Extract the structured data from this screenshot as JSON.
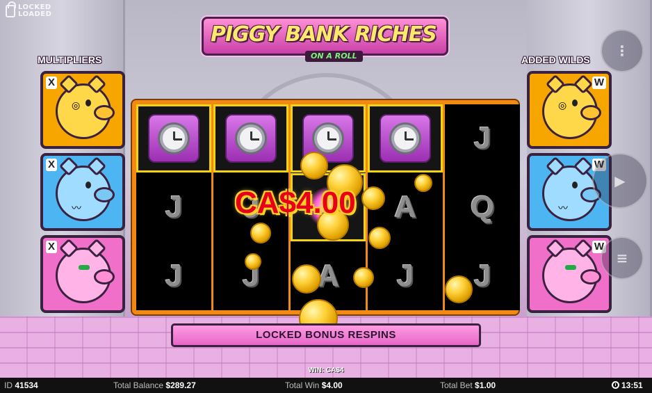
{
  "brand": {
    "line1": "LOCKED",
    "line2": "LOADED"
  },
  "logo": {
    "title": "PIGGY BANK RICHES",
    "subtitle": "ON A ROLL"
  },
  "left_panel": {
    "title": "MULTIPLIERS",
    "slots": [
      {
        "tag": "X",
        "pig": "gold-piggy-monocle-icon"
      },
      {
        "tag": "X",
        "pig": "blue-piggy-mustache-icon"
      },
      {
        "tag": "X",
        "pig": "pink-piggy-sunglasses-icon"
      }
    ]
  },
  "right_panel": {
    "title": "ADDED WILDS",
    "slots": [
      {
        "tag": "W",
        "pig": "gold-piggy-monocle-icon"
      },
      {
        "tag": "W",
        "pig": "blue-piggy-mustache-icon"
      },
      {
        "tag": "W",
        "pig": "pink-piggy-sunglasses-icon"
      }
    ]
  },
  "reels": {
    "columns": [
      [
        "watch",
        "J",
        "J"
      ],
      [
        "watch",
        "J",
        "J"
      ],
      [
        "watch",
        "glow",
        "A"
      ],
      [
        "watch",
        "A",
        "J"
      ],
      [
        "J",
        "Q",
        "J"
      ]
    ]
  },
  "win_amount": "CA$4.00",
  "respins_label": "LOCKED BONUS RESPINS",
  "win_small": "WIN: CA$4",
  "status": {
    "id_label": "ID",
    "id_value": "41534",
    "balance_label": "Total Balance",
    "balance_value": "$289.27",
    "win_label": "Total Win",
    "win_value": "$4.00",
    "bet_label": "Total Bet",
    "bet_value": "$1.00",
    "time": "13:51"
  },
  "controls": [
    "menu-icon",
    "spin-icon",
    "bet-stack-icon"
  ],
  "colors": {
    "reel_frame": "#f08a14",
    "locked_border": "#f4d312",
    "win_text": "#e8001a",
    "respins_bar": "#ff9ce2"
  }
}
